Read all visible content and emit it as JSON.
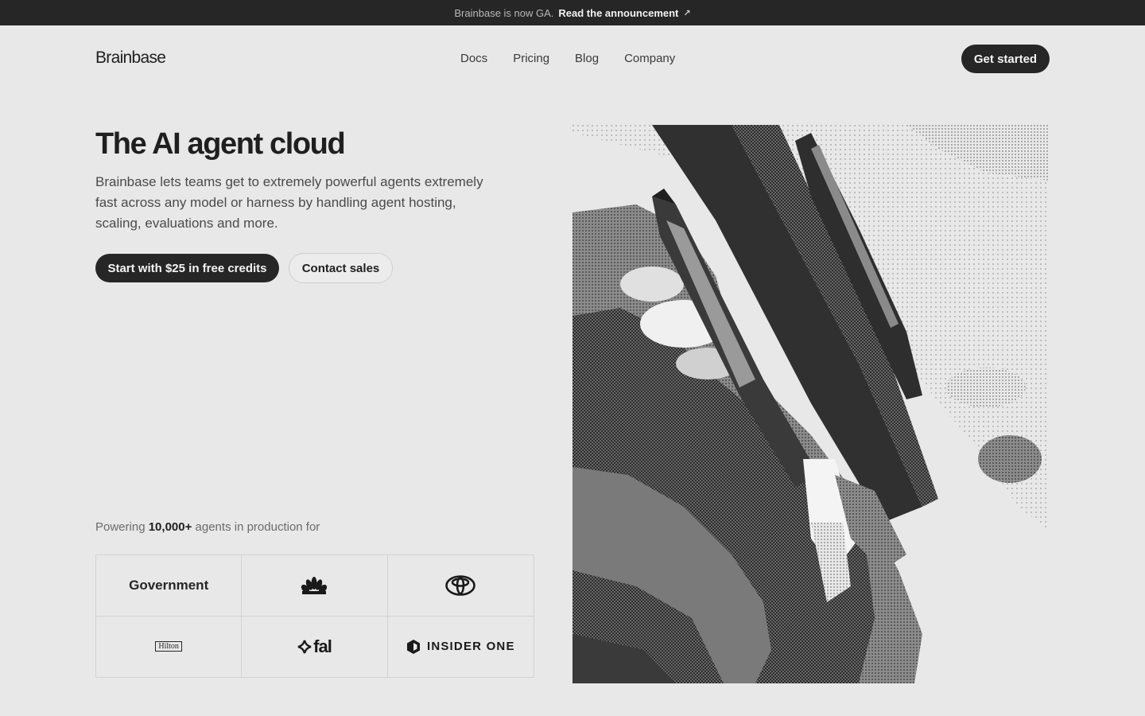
{
  "banner": {
    "text": "Brainbase is now GA.",
    "link_label": "Read the announcement",
    "link_icon": "arrow-up-right-icon"
  },
  "nav": {
    "logo": "Brainbase",
    "links": [
      "Docs",
      "Pricing",
      "Blog",
      "Company"
    ],
    "cta": "Get started"
  },
  "hero": {
    "title": "The AI agent cloud",
    "description": "Brainbase lets teams get to extremely powerful agents extremely fast across any model or harness by handling agent hosting, scaling, evaluations and more.",
    "primary_cta": "Start with $25 in free credits",
    "secondary_cta": "Contact sales"
  },
  "social_proof": {
    "prefix": "Powering",
    "count": "10,000+",
    "suffix": "agents in production for",
    "logos": {
      "government": "Government",
      "nbc": "nbc-peacock-icon",
      "toyota": "toyota-icon",
      "hilton": "Hilton",
      "fal": "fal",
      "insider": "INSIDER ONE"
    }
  },
  "colors": {
    "background": "#e8e8e8",
    "dark": "#262626",
    "text_muted": "#4a4a4a"
  }
}
